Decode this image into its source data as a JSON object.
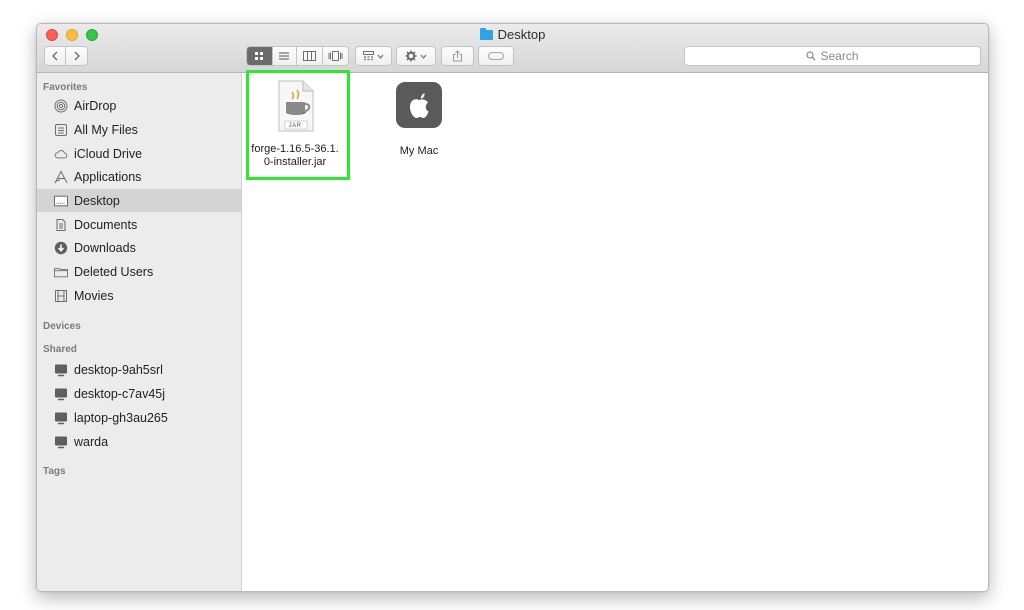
{
  "window": {
    "title": "Desktop"
  },
  "toolbar": {
    "search_placeholder": "Search",
    "view_modes": [
      "icon-view",
      "list-view",
      "column-view",
      "cover-flow-view"
    ],
    "active_view": "icon-view"
  },
  "sidebar": {
    "favorites_header": "Favorites",
    "favorites": [
      {
        "label": "AirDrop",
        "icon": "airdrop-icon"
      },
      {
        "label": "All My Files",
        "icon": "all-files-icon"
      },
      {
        "label": "iCloud Drive",
        "icon": "cloud-icon"
      },
      {
        "label": "Applications",
        "icon": "applications-icon"
      },
      {
        "label": "Desktop",
        "icon": "desktop-icon",
        "selected": true
      },
      {
        "label": "Documents",
        "icon": "documents-icon"
      },
      {
        "label": "Downloads",
        "icon": "downloads-icon"
      },
      {
        "label": "Deleted Users",
        "icon": "folder-icon"
      },
      {
        "label": "Movies",
        "icon": "movies-icon"
      }
    ],
    "devices_header": "Devices",
    "shared_header": "Shared",
    "shared": [
      {
        "label": "desktop-9ah5srl",
        "icon": "computer-icon"
      },
      {
        "label": "desktop-c7av45j",
        "icon": "computer-icon"
      },
      {
        "label": "laptop-gh3au265",
        "icon": "computer-icon"
      },
      {
        "label": "warda",
        "icon": "computer-icon"
      }
    ],
    "tags_header": "Tags"
  },
  "files": [
    {
      "line1": "forge-1.16.5-36.1.",
      "line2": "0-installer.jar",
      "icon": "jar-file-icon",
      "badge": "JAR",
      "highlighted": true
    },
    {
      "line1": "My Mac",
      "line2": "",
      "icon": "apple-app-icon"
    }
  ],
  "colors": {
    "highlight_border": "#2ee82e",
    "sidebar_bg": "#ececec",
    "selected_row": "#d4d4d4"
  }
}
